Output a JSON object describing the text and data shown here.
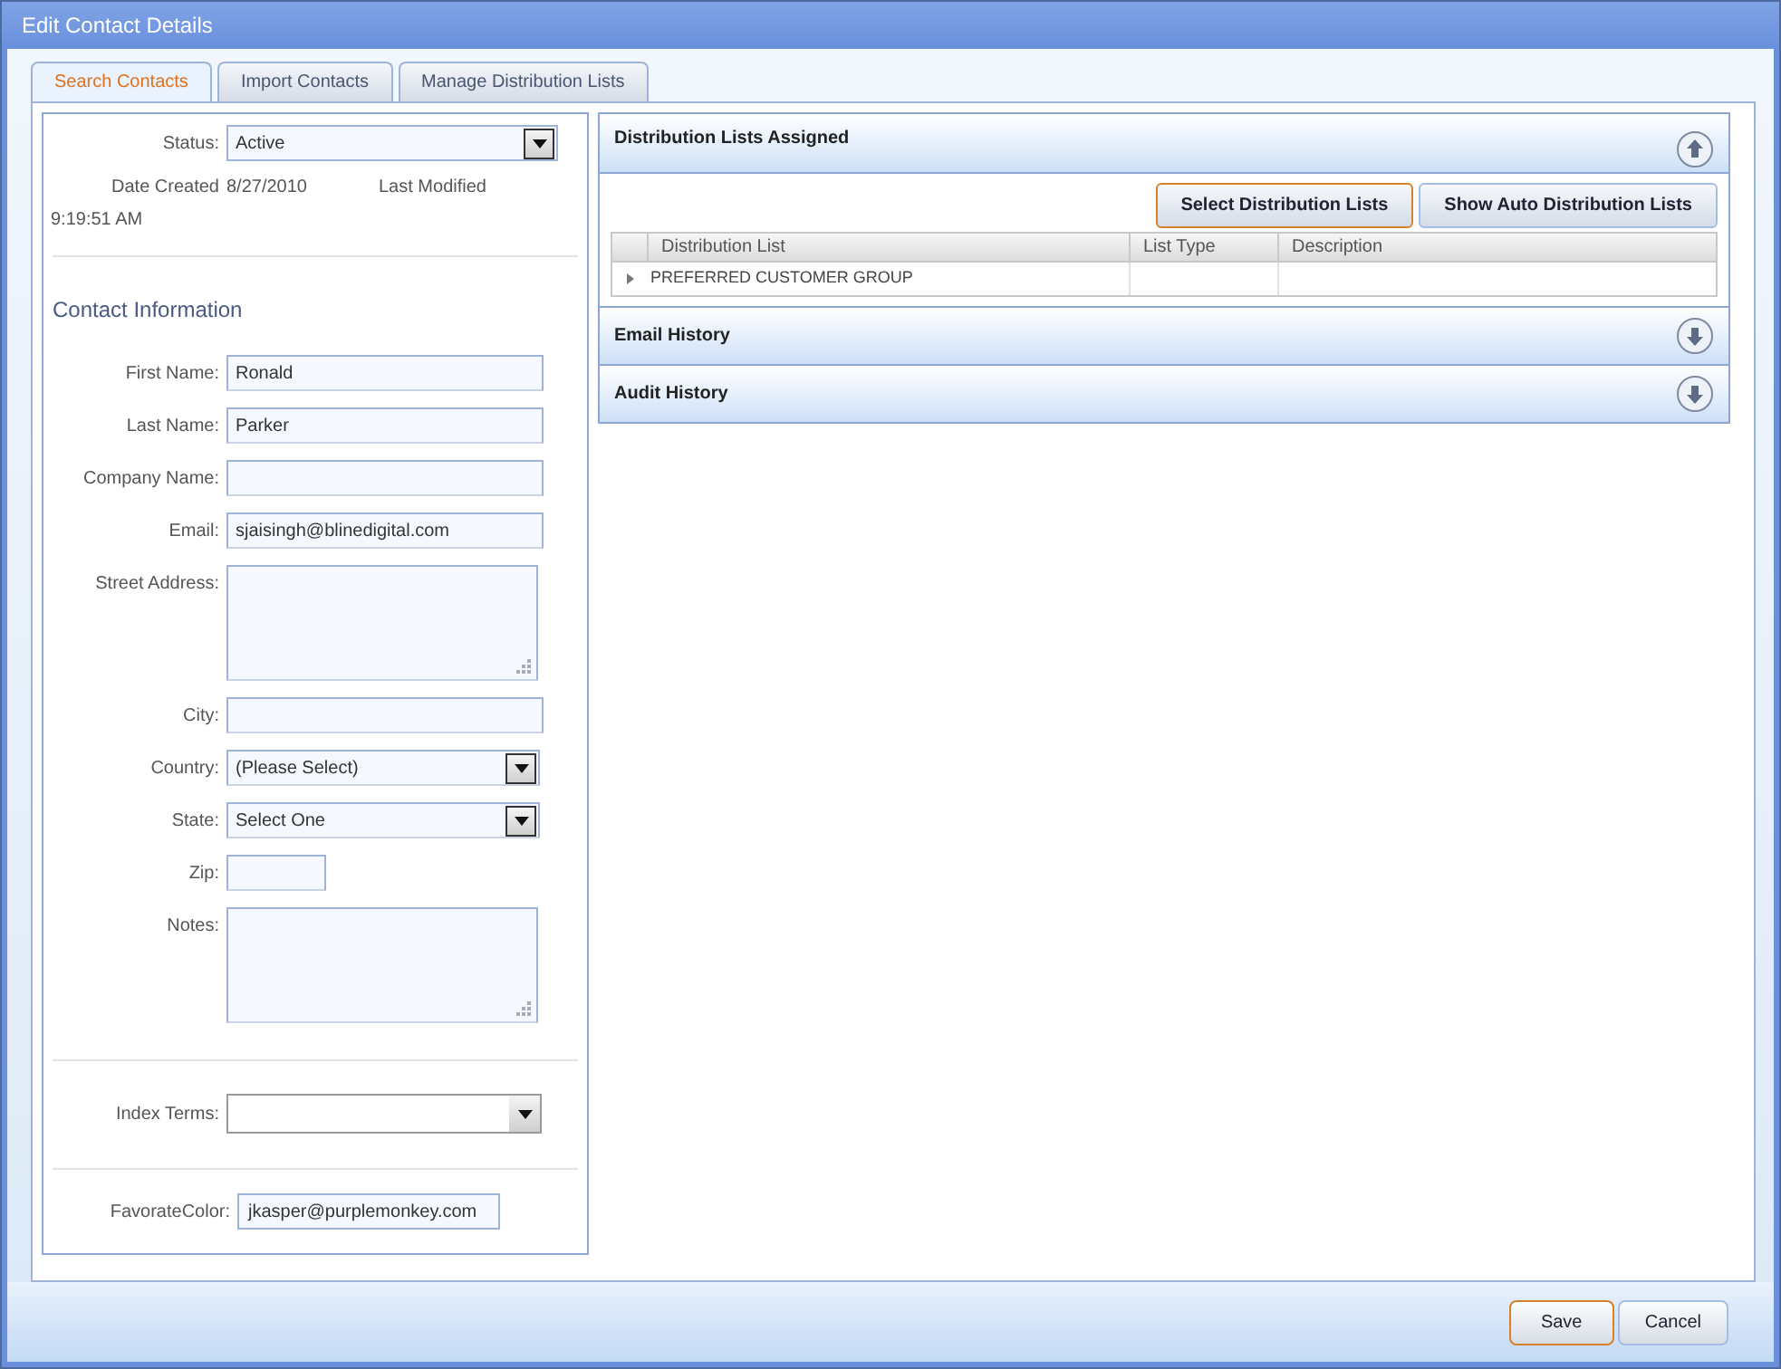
{
  "window": {
    "title": "Edit Contact Details"
  },
  "tabs": [
    {
      "label": "Search Contacts",
      "selected": true
    },
    {
      "label": "Import Contacts",
      "selected": false
    },
    {
      "label": "Manage Distribution Lists",
      "selected": false
    }
  ],
  "status": {
    "label": "Status:",
    "value": "Active"
  },
  "date_created": {
    "label": "Date Created",
    "value": "8/27/2010"
  },
  "last_modified": {
    "label": "Last Modified",
    "value": "9:19:51 AM"
  },
  "contact_section": {
    "title": "Contact Information"
  },
  "fields": [
    {
      "kind": "text",
      "label": "First Name:",
      "value": "Ronald"
    },
    {
      "kind": "text",
      "label": "Last Name:",
      "value": "Parker"
    },
    {
      "kind": "text",
      "label": "Company Name:"
    },
    {
      "kind": "text",
      "label": "Email:",
      "value": "sjaisingh@blinedigital.com"
    },
    {
      "kind": "textarea",
      "label": "Street Address:"
    },
    {
      "kind": "text",
      "label": "City:"
    },
    {
      "kind": "select",
      "label": "Country:",
      "value": "(Please Select)"
    },
    {
      "kind": "select",
      "label": "State:",
      "value": "Select One"
    },
    {
      "kind": "short",
      "label": "Zip:"
    },
    {
      "kind": "textarea",
      "label": "Notes:"
    }
  ],
  "index_terms": {
    "label": "Index Terms:"
  },
  "favorite_color": {
    "label": "FavorateColor:",
    "value": "jkasper@purplemonkey.com"
  },
  "sections": [
    {
      "title": "Distribution Lists Assigned",
      "expanded": true,
      "buttons": [
        {
          "label": "Select Distribution Lists",
          "highlighted": true
        },
        {
          "label": "Show Auto Distribution Lists",
          "highlighted": false
        }
      ],
      "table": {
        "columns": [
          "Distribution List",
          "List Type",
          "Description"
        ],
        "rows": [
          [
            "PREFERRED CUSTOMER GROUP"
          ]
        ]
      }
    },
    {
      "title": "Email History",
      "expanded": false
    },
    {
      "title": "Audit History",
      "expanded": false
    }
  ],
  "buttons": [
    {
      "label": "Save",
      "highlighted": true
    },
    {
      "label": "Cancel",
      "highlighted": false
    }
  ]
}
